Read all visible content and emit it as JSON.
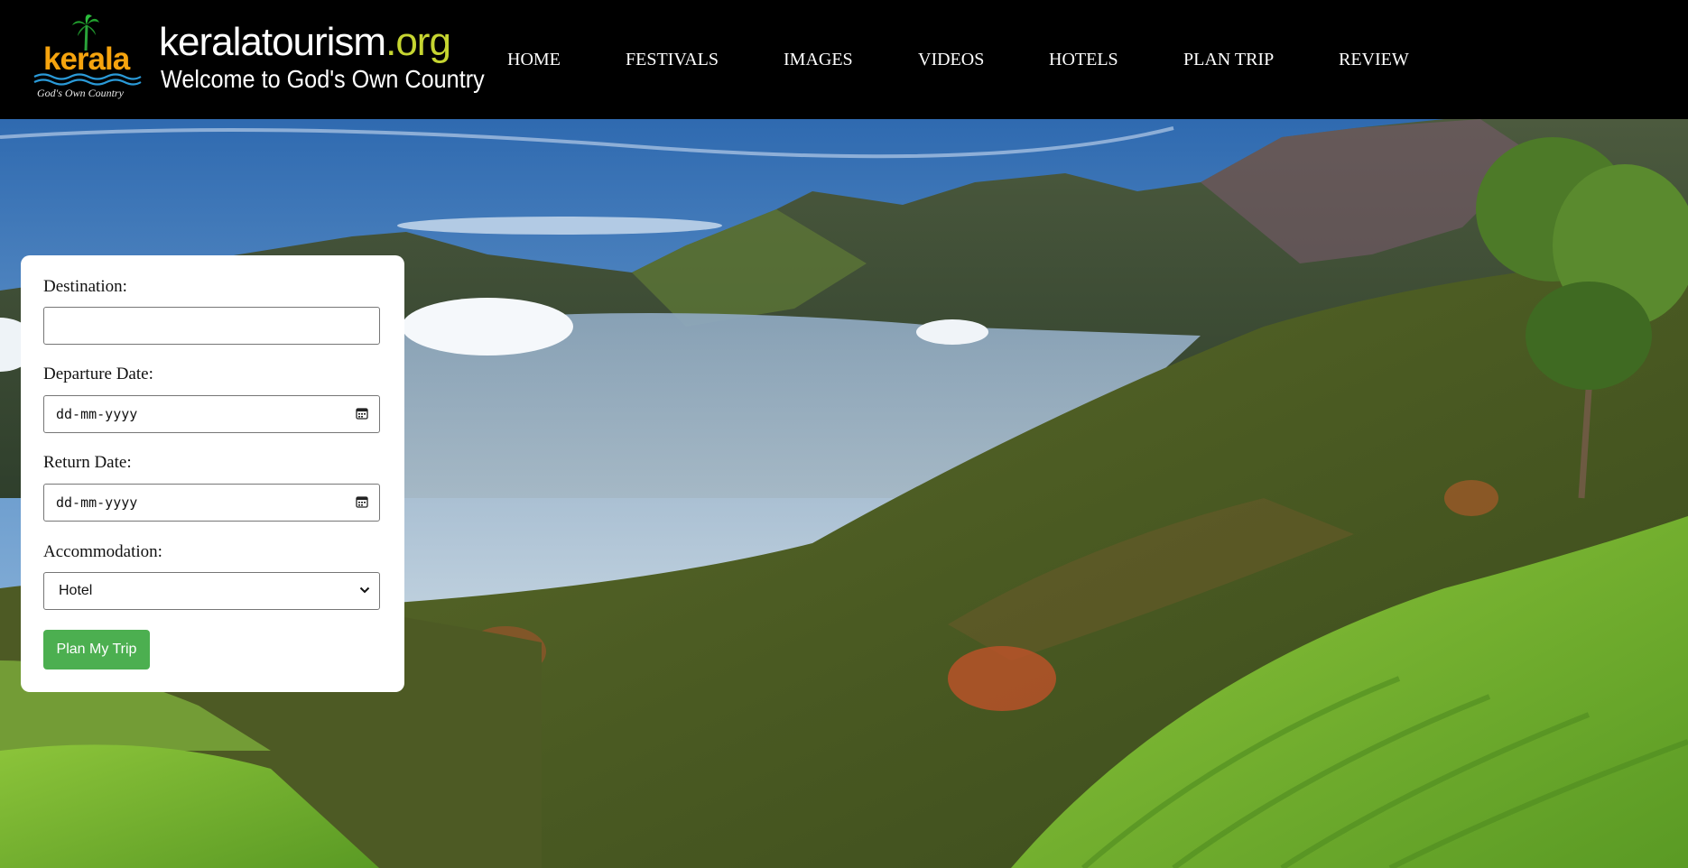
{
  "header": {
    "logo": {
      "wordmark": "kerala",
      "tagline": "God's Own Country"
    },
    "site": {
      "name": "keralatourism",
      "tld": ".org",
      "subtitle": "Welcome to God's Own Country"
    },
    "nav": [
      {
        "label": "HOME"
      },
      {
        "label": "FESTIVALS"
      },
      {
        "label": "IMAGES"
      },
      {
        "label": "VIDEOS"
      },
      {
        "label": "HOTELS"
      },
      {
        "label": "PLAN TRIP"
      },
      {
        "label": "REVIEW"
      }
    ]
  },
  "form": {
    "destination": {
      "label": "Destination:",
      "value": ""
    },
    "departure": {
      "label": "Departure Date:",
      "placeholder": "dd-mm-yyyy"
    },
    "return": {
      "label": "Return Date:",
      "placeholder": "dd-mm-yyyy"
    },
    "accommodation": {
      "label": "Accommodation:",
      "selected": "Hotel"
    },
    "submit_label": "Plan My Trip"
  },
  "colors": {
    "header_bg": "#000000",
    "tld_accent": "#c6d531",
    "button_bg": "#4caf50"
  },
  "icons": [
    "palm-tree-icon",
    "calendar-icon",
    "chevron-down-icon"
  ]
}
